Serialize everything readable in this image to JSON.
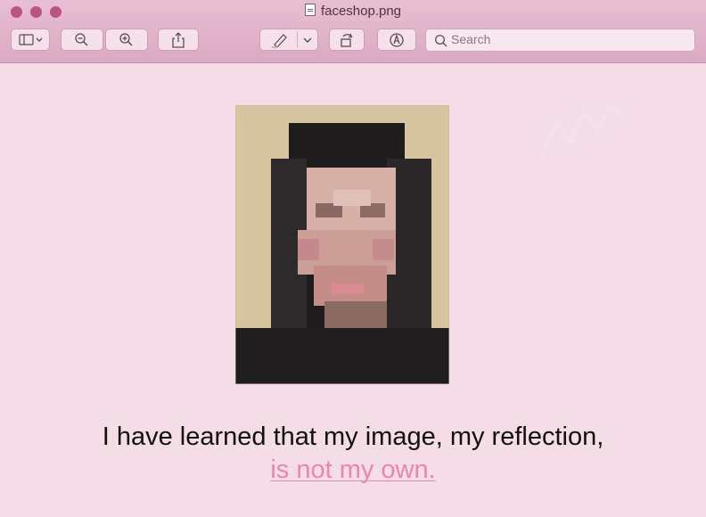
{
  "window": {
    "title": "faceshop.png",
    "controls": [
      "close-button",
      "minimize-button",
      "zoom-button"
    ]
  },
  "toolbar": {
    "search": {
      "placeholder": "Search"
    },
    "icons": [
      "sidebar-icon",
      "zoom-out-icon",
      "zoom-in-icon",
      "share-icon",
      "markup-pen-icon",
      "chevron-down-icon",
      "rotate-icon",
      "annotate-icon"
    ]
  },
  "content": {
    "caption_line1": "I have learned that my image, my reflection,",
    "caption_line2": "is not my own."
  },
  "colors": {
    "accent": "#e985b3",
    "window_bg": "#f4dde7",
    "titlebar": "#dba9c2"
  }
}
